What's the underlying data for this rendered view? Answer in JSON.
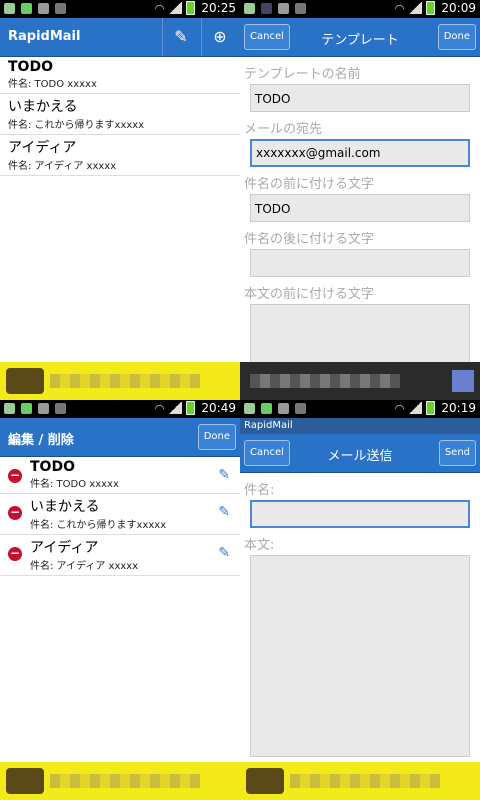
{
  "panel1": {
    "status": {
      "time": "20:25"
    },
    "title": "RapidMail",
    "icons": [
      "pencil-icon",
      "plus-circle-icon"
    ],
    "items": [
      {
        "title": "TODO",
        "subject": "件名:   TODO xxxxx"
      },
      {
        "title": "いまかえる",
        "subject": "件名:   これから帰りますxxxxx"
      },
      {
        "title": "アイディア",
        "subject": "件名:   アイディア xxxxx"
      }
    ]
  },
  "panel2": {
    "status": {
      "time": "20:09"
    },
    "cancel": "Cancel",
    "title": "テンプレート",
    "done": "Done",
    "labels": {
      "name": "テンプレートの名前",
      "to": "メールの宛先",
      "prefix": "件名の前に付ける文字",
      "suffix": "件名の後に付ける文字",
      "body_prefix": "本文の前に付ける文字"
    },
    "values": {
      "name": "TODO",
      "to": "xxxxxxx@gmail.com",
      "prefix": "TODO",
      "suffix": ""
    }
  },
  "panel3": {
    "status": {
      "time": "20:49"
    },
    "title": "編集 / 削除",
    "done": "Done",
    "items": [
      {
        "title": "TODO",
        "subject": "件名:   TODO xxxxx"
      },
      {
        "title": "いまかえる",
        "subject": "件名:   これから帰りますxxxxx"
      },
      {
        "title": "アイディア",
        "subject": "件名:   アイディア xxxxx"
      }
    ]
  },
  "panel4": {
    "status": {
      "time": "20:19"
    },
    "app": "RapidMail",
    "cancel": "Cancel",
    "title": "メール送信",
    "send": "Send",
    "labels": {
      "subject": "件名:",
      "body": "本文:"
    }
  },
  "colors": {
    "accent": "#2a72c8",
    "delete": "#c8102e",
    "ad_yellow": "#f3ea1a"
  }
}
